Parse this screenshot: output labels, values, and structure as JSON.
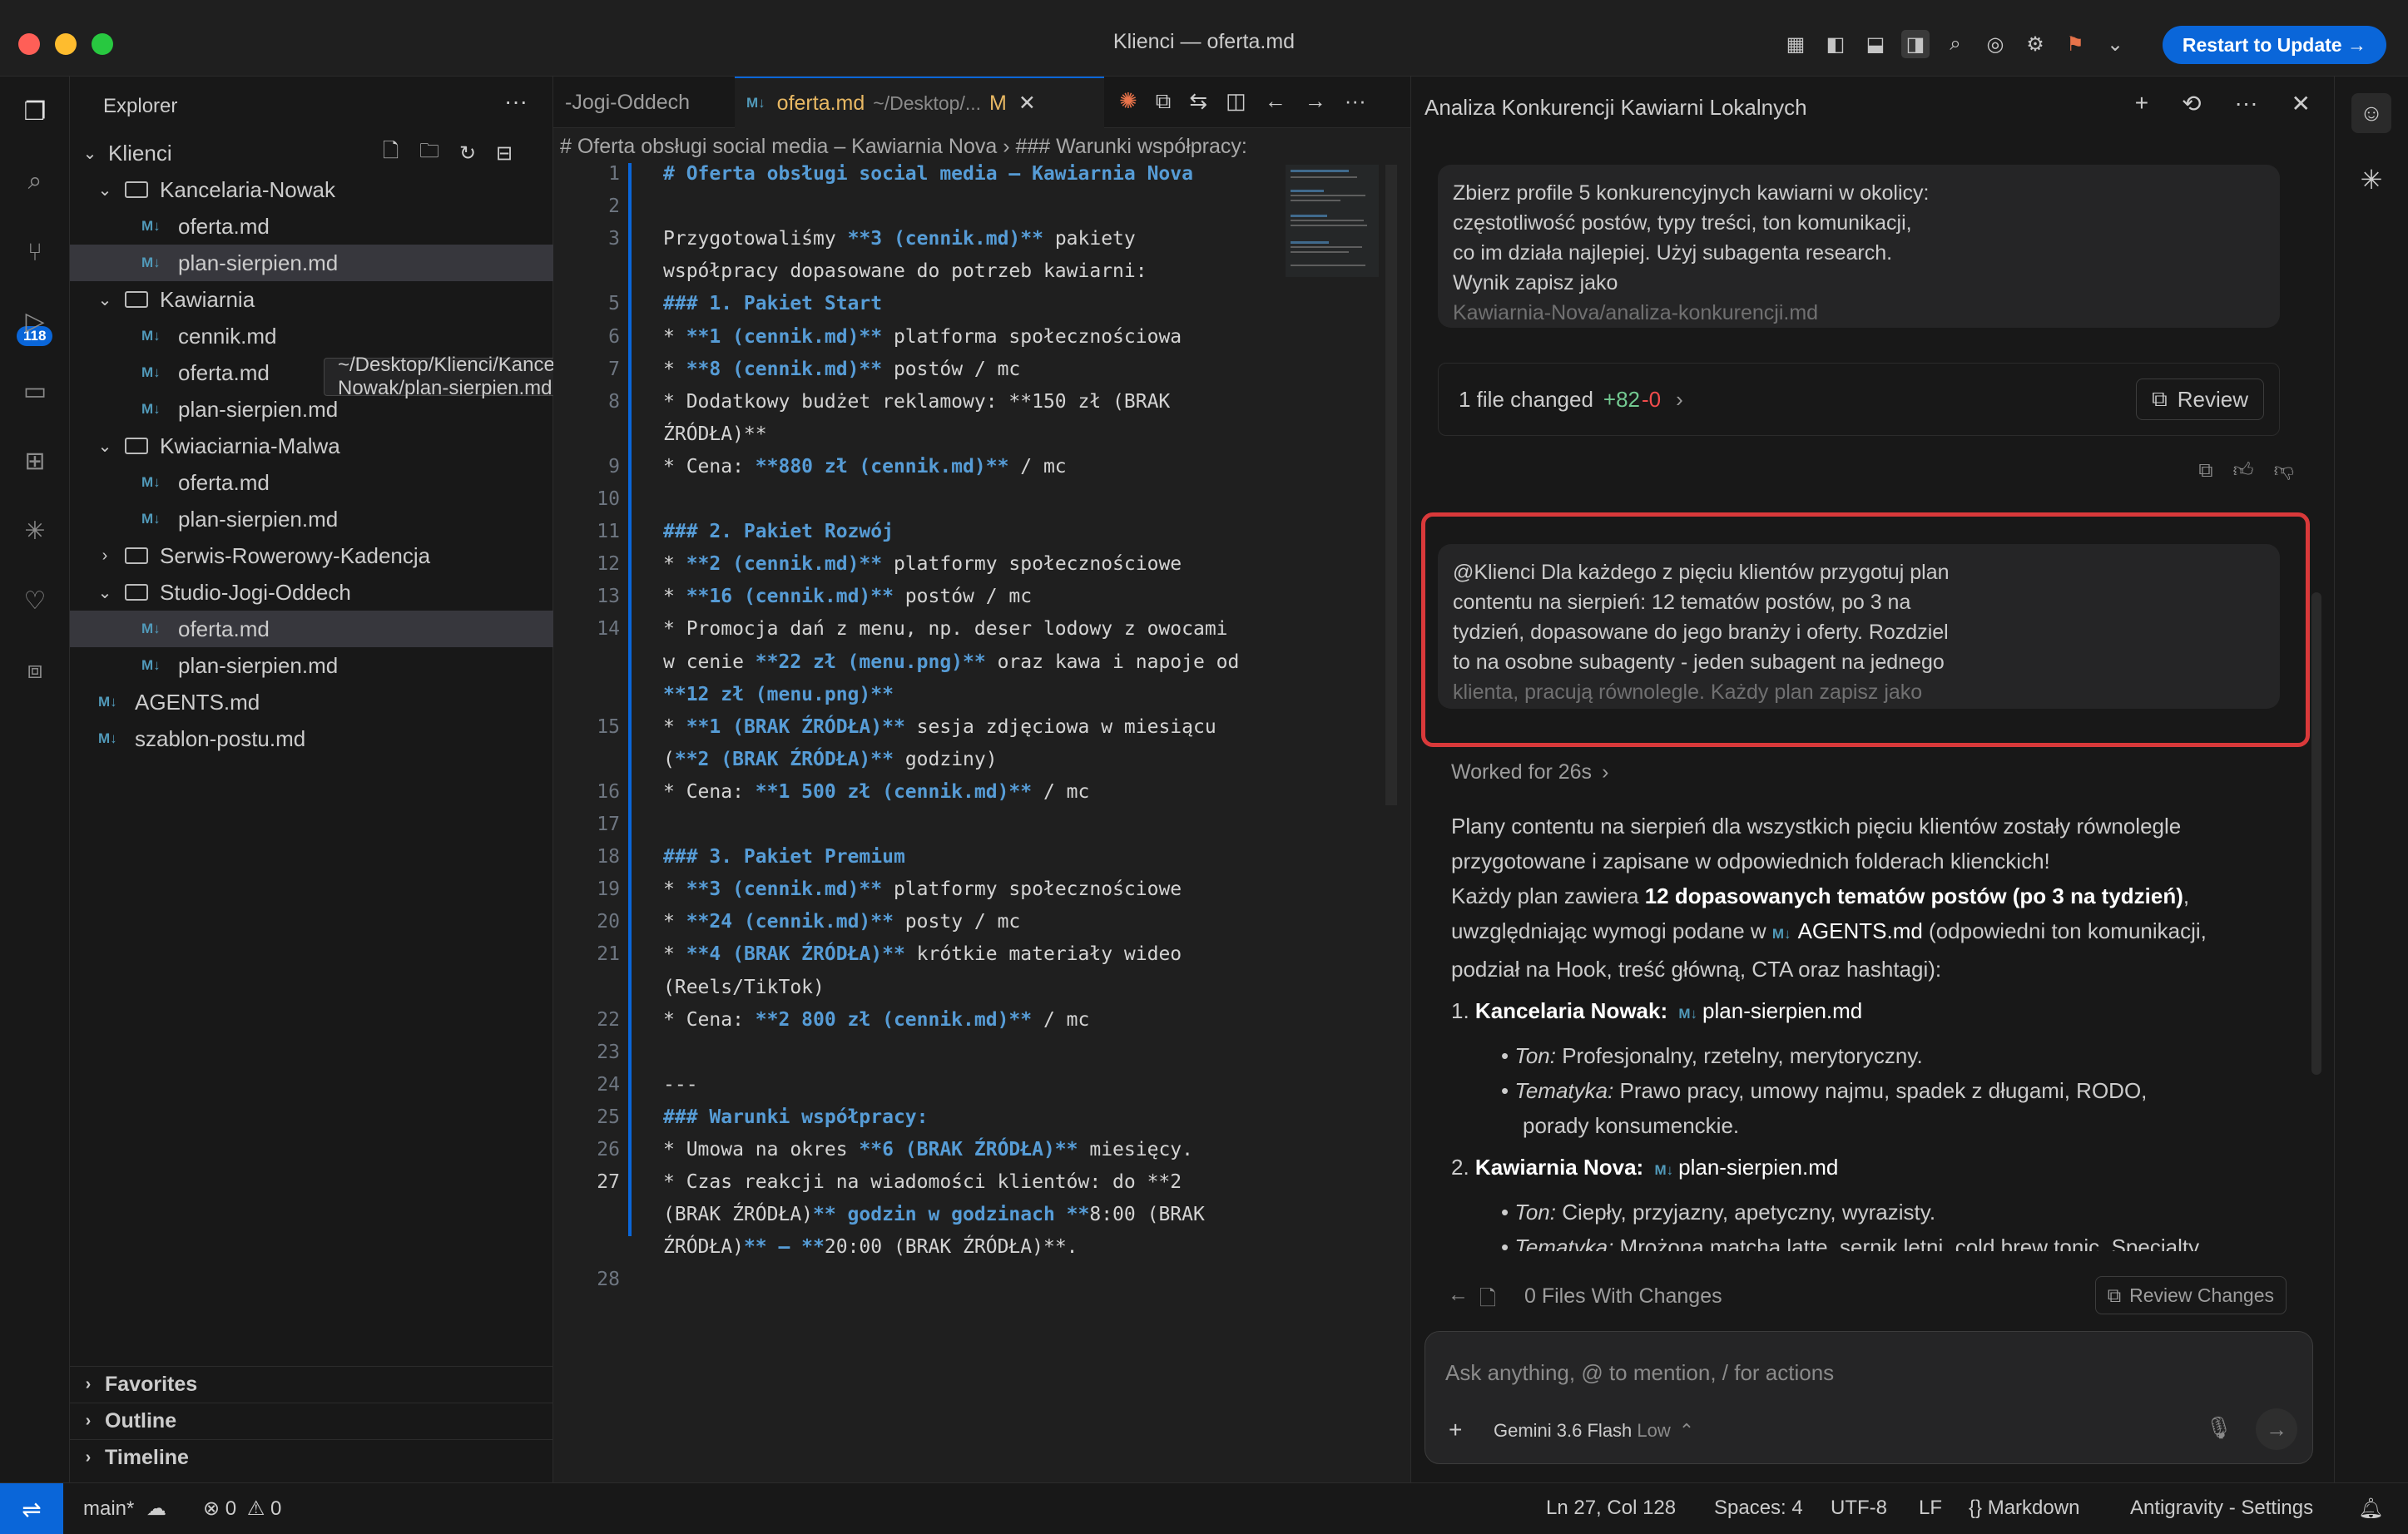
{
  "window": {
    "title": "Klienci — oferta.md",
    "restart_label": "Restart to Update →"
  },
  "activity": {
    "scm_badge": "118"
  },
  "explorer": {
    "header": "Explorer",
    "root": "Klienci",
    "tooltip": "~/Desktop/Klienci/Kancelaria-Nowak/plan-sierpien.md",
    "items": [
      {
        "label": "Kancelaria-Nowak",
        "kind": "folder"
      },
      {
        "label": "oferta.md",
        "kind": "file"
      },
      {
        "label": "plan-sierpien.md",
        "kind": "file"
      },
      {
        "label": "Kawiarnia",
        "kind": "folder"
      },
      {
        "label": "cennik.md",
        "kind": "file"
      },
      {
        "label": "oferta.md",
        "kind": "file"
      },
      {
        "label": "plan-sierpien.md",
        "kind": "file"
      },
      {
        "label": "Kwiaciarnia-Malwa",
        "kind": "folder"
      },
      {
        "label": "oferta.md",
        "kind": "file"
      },
      {
        "label": "plan-sierpien.md",
        "kind": "file"
      },
      {
        "label": "Serwis-Rowerowy-Kadencja",
        "kind": "folder"
      },
      {
        "label": "Studio-Jogi-Oddech",
        "kind": "folder"
      },
      {
        "label": "oferta.md",
        "kind": "file"
      },
      {
        "label": "plan-sierpien.md",
        "kind": "file"
      },
      {
        "label": "AGENTS.md",
        "kind": "file"
      },
      {
        "label": "szablon-postu.md",
        "kind": "file"
      }
    ],
    "sections": [
      "Favorites",
      "Outline",
      "Timeline"
    ]
  },
  "editor": {
    "tab_prev": "-Jogi-Oddech",
    "tab_active": "oferta.md",
    "tab_active_path": "~/Desktop/...",
    "tab_active_status": "M",
    "breadcrumb": "# Oferta obsługi social media – Kawiarnia Nova  ›  ### Warunki współpracy:",
    "current_line": "27"
  },
  "code_lines": [
    {
      "n": "1",
      "t": "# Oferta obsługi social media – Kawiarnia Nova"
    },
    {
      "n": "2",
      "t": ""
    },
    {
      "n": "3",
      "t": "Przygotowaliśmy **3 (cennik.md)** pakiety"
    },
    {
      "n": "",
      "t": "współpracy dopasowane do potrzeb kawiarni:"
    },
    {
      "n": "5",
      "t": "### 1. Pakiet Start"
    },
    {
      "n": "6",
      "t": "* **1 (cennik.md)** platforma społecznościowa"
    },
    {
      "n": "7",
      "t": "* **8 (cennik.md)** postów / mc"
    },
    {
      "n": "8",
      "t": "* Dodatkowy budżet reklamowy: **150 zł (BRAK"
    },
    {
      "n": "",
      "t": "ŹRÓDŁA)**"
    },
    {
      "n": "9",
      "t": "* Cena: **880 zł (cennik.md)** / mc"
    },
    {
      "n": "10",
      "t": ""
    },
    {
      "n": "11",
      "t": "### 2. Pakiet Rozwój"
    },
    {
      "n": "12",
      "t": "* **2 (cennik.md)** platformy społecznościowe"
    },
    {
      "n": "13",
      "t": "* **16 (cennik.md)** postów / mc"
    },
    {
      "n": "14",
      "t": "* Promocja dań z menu, np. deser lodowy z owocami"
    },
    {
      "n": "",
      "t": "w cenie **22 zł (menu.png)** oraz kawa i napoje od"
    },
    {
      "n": "",
      "t": "**12 zł (menu.png)**"
    },
    {
      "n": "15",
      "t": "* **1 (BRAK ŹRÓDŁA)** sesja zdjęciowa w miesiącu"
    },
    {
      "n": "",
      "t": "(**2 (BRAK ŹRÓDŁA)** godziny)"
    },
    {
      "n": "16",
      "t": "* Cena: **1 500 zł (cennik.md)** / mc"
    },
    {
      "n": "17",
      "t": ""
    },
    {
      "n": "18",
      "t": "### 3. Pakiet Premium"
    },
    {
      "n": "19",
      "t": "* **3 (cennik.md)** platformy społecznościowe"
    },
    {
      "n": "20",
      "t": "* **24 (cennik.md)** posty / mc"
    },
    {
      "n": "21",
      "t": "* **4 (BRAK ŹRÓDŁA)** krótkie materiały wideo"
    },
    {
      "n": "",
      "t": "(Reels/TikTok)"
    },
    {
      "n": "22",
      "t": "* Cena: **2 800 zł (cennik.md)** / mc"
    },
    {
      "n": "23",
      "t": ""
    },
    {
      "n": "24",
      "t": "---"
    },
    {
      "n": "25",
      "t": "### Warunki współpracy:"
    },
    {
      "n": "26",
      "t": "* Umowa na okres **6 (BRAK ŹRÓDŁA)** miesięcy."
    },
    {
      "n": "27",
      "t": "* Czas reakcji na wiadomości klientów: do **2"
    },
    {
      "n": "",
      "t": "(BRAK ŹRÓDŁA)** godzin w godzinach **8:00 (BRAK"
    },
    {
      "n": "",
      "t": "ŹRÓDŁA)** – **20:00 (BRAK ŹRÓDŁA)**."
    },
    {
      "n": "28",
      "t": ""
    }
  ],
  "panel": {
    "title": "Analiza Konkurencji Kawiarni Lokalnych",
    "msg1": [
      "Zbierz profile 5 konkurencyjnych kawiarni w okolicy:",
      "częstotliwość postów, typy treści, ton komunikacji,",
      "co im działa najlepiej. Użyj subagenta research.",
      "Wynik zapisz jako",
      "Kawiarnia-Nova/analiza-konkurencji.md"
    ],
    "files_changed": "1 file changed",
    "added": "+82",
    "removed": "-0",
    "review_label": "Review",
    "msg2": [
      "@Klienci Dla każdego z pięciu klientów przygotuj plan",
      "contentu na sierpień: 12 tematów postów, po 3 na",
      "tydzień, dopasowane do jego branży i oferty. Rozdziel",
      "to na osobne subagenty - jeden subagent na jednego",
      "klienta, pracują równolegle. Każdy plan zapisz jako"
    ],
    "worked": "Worked for 26s",
    "resp1": "Plany contentu na sierpień dla wszystkich pięciu klientów zostały równolegle",
    "resp2": "przygotowane i zapisane w odpowiednich folderach klienckich!",
    "resp3a": "Każdy plan zawiera ",
    "resp3b": "12 dopasowanych tematów postów (po 3 na tydzień)",
    "resp3c": ",",
    "resp4a": "uwzględniając wymogi podane w ",
    "resp4b": "AGENTS.md",
    "resp4c": " (odpowiedni ton komunikacji,",
    "resp5": "podział na Hook, treść główną, CTA oraz hashtagi):",
    "item1_name": "Kancelaria Nowak:",
    "item1_file": "plan-sierpien.md",
    "item1_ton_label": "Ton:",
    "item1_ton": " Profesjonalny, rzetelny, merytoryczny.",
    "item1_tem_label": "Tematyka:",
    "item1_tem": " Prawo pracy, umowy najmu, spadek z długami, RODO,",
    "item1_tem2": "porady konsumenckie.",
    "item2_name": "Kawiarnia Nova:",
    "item2_file": "plan-sierpien.md",
    "item2_ton_label": "Ton:",
    "item2_ton": " Ciepły, przyjazny, apetyczny, wyrazisty.",
    "item2_tem_label": "Tematyka:",
    "item2_tem": " Mrożona matcha latte, sernik letni, cold brew tonic, Specialty",
    "files_with_changes": "0 Files With Changes",
    "review_changes": "Review Changes",
    "input_placeholder": "Ask anything, @ to mention, / for actions",
    "model": "Gemini 3.6 Flash",
    "model_level": "Low"
  },
  "status": {
    "branch": "main*",
    "errors": "0",
    "warnings": "0",
    "position": "Ln 27, Col 128",
    "spaces": "Spaces: 4",
    "encoding": "UTF-8",
    "eol": "LF",
    "language": "Markdown",
    "settings": "Antigravity - Settings"
  }
}
